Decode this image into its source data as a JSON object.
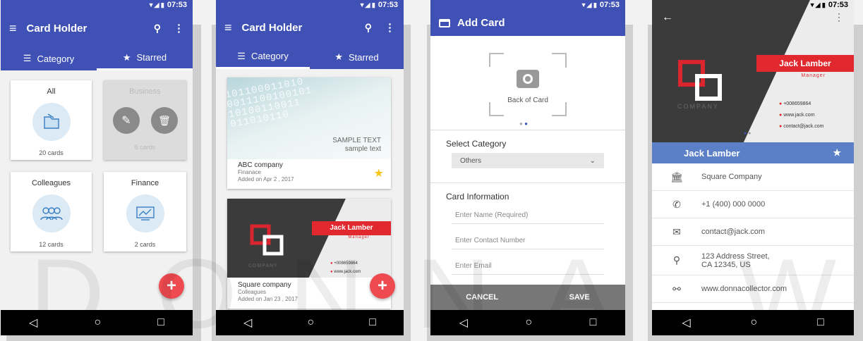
{
  "status": {
    "time": "07:53"
  },
  "colors": {
    "primary": "#3f51b5",
    "accent": "#ef4a4f",
    "blue_bar": "#5b80c7",
    "dark": "#3a3a3a"
  },
  "screen1": {
    "title": "Card Holder",
    "tabs": [
      "Category",
      "Starred"
    ],
    "cards": [
      {
        "title": "All",
        "count": "20 cards",
        "icon": "folder-icon"
      },
      {
        "title": "Business",
        "count": "6 cards",
        "icon": "briefcase-icon"
      },
      {
        "title": "Colleagues",
        "count": "12 cards",
        "icon": "people-icon"
      },
      {
        "title": "Finance",
        "count": "2 cards",
        "icon": "chart-icon"
      }
    ]
  },
  "screen2": {
    "title": "Card Holder",
    "tabs": [
      "Category",
      "Starred"
    ],
    "card1": {
      "sample1": "SAMPLE TEXT",
      "sample2": "sample text",
      "company": "ABC company",
      "category": "Finanace",
      "added": "Added on Apr 2 , 2017"
    },
    "card2": {
      "name": "Jack Lamber",
      "role": "Manager",
      "logo_text": "COMPANY",
      "phone": "+008659864",
      "web": "www.jack.com",
      "company": "Square company",
      "category": "Colleagues",
      "added": "Added on Jan 23 , 2017"
    }
  },
  "screen3": {
    "title": "Add Card",
    "photo_label": "Back of Card",
    "select_label": "Select Category",
    "select_value": "Others",
    "info_label": "Card Information",
    "placeholders": [
      "Enter Name (Required)",
      "Enter Contact Number",
      "Enter Email"
    ],
    "cancel": "CANCEL",
    "save": "SAVE"
  },
  "screen4": {
    "card": {
      "name": "Jack Lamber",
      "role": "Manager",
      "logo_text": "COMPANY",
      "phone": "+008659864",
      "web": "www.jack.com",
      "email": "contact@jack.com"
    },
    "header_name": "Jack Lamber",
    "rows": [
      {
        "icon": "bank-icon",
        "text": "Square Company"
      },
      {
        "icon": "phone-icon",
        "text": "+1 (400) 000 0000"
      },
      {
        "icon": "mail-icon",
        "text": "contact@jack.com"
      },
      {
        "icon": "pin-icon",
        "text": "123 Address Street,\nCA 12345, US"
      },
      {
        "icon": "link-icon",
        "text": "www.donnacollector.com"
      }
    ]
  },
  "watermark": "DONNA WONG"
}
